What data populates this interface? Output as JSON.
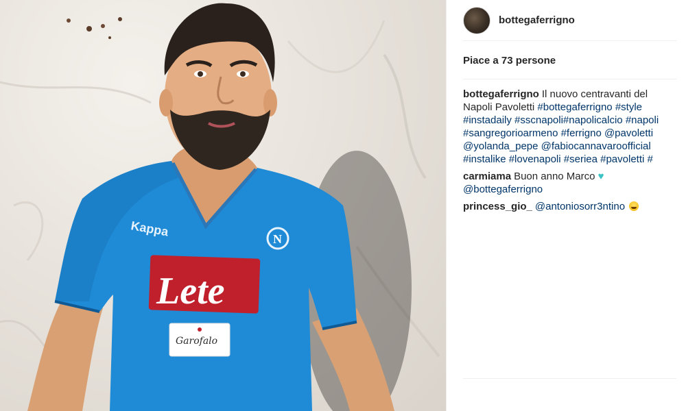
{
  "post": {
    "username": "bottegaferrigno",
    "likes_text": "Piace a 73 persone"
  },
  "photo": {
    "jersey_sponsor": "Lete",
    "jersey_brand": "Kappa",
    "jersey_badge": "N",
    "jersey_sub_sponsor": "Garofalo"
  },
  "comments": [
    {
      "user": "bottegaferrigno",
      "text": "Il nuovo centravanti del Napoli Pavoletti",
      "tags": "#bottegaferrigno #style #instadaily #sscnapoli#napolicalcio #napoli #sangregorioarmeno #ferrigno @pavoletti @yolanda_pepe @fabiocannavaroofficial #instalike #lovenapoli #seriea #pavoletti #"
    },
    {
      "user": "carmiama",
      "text": "Buon anno Marco",
      "heart": "♥",
      "mention": "@bottegaferrigno"
    },
    {
      "user": "princess_gio_",
      "mention": "@antoniosorr3ntino",
      "emoji": "grinning-sweat-emoji"
    }
  ],
  "colors": {
    "jersey_blue": "#1f8bd6",
    "sponsor_red": "#c0202c",
    "link_blue": "#003569",
    "heart": "#3bc3c4"
  }
}
